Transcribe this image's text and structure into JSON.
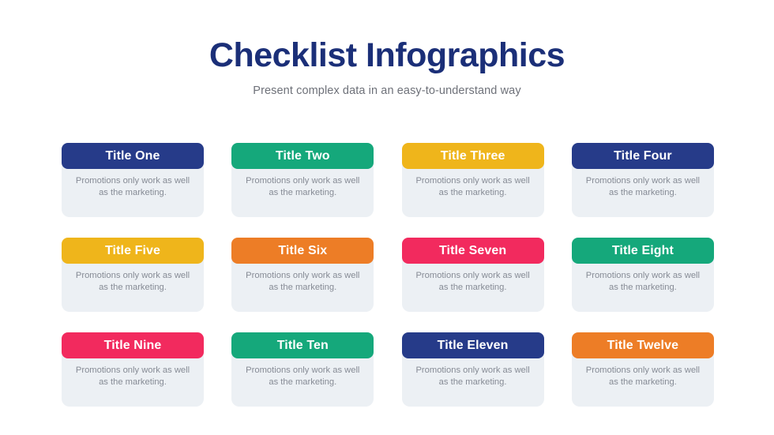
{
  "header": {
    "title": "Checklist Infographics",
    "subtitle": "Present complex data in an easy-to-understand way",
    "title_color": "#1b2f78",
    "subtitle_color": "#6e7179"
  },
  "theme": {
    "background": "#ffffff",
    "card_body_bg": "#ecf0f4",
    "card_text_color": "#868b95",
    "navy": "#263b89",
    "green": "#15a87b",
    "yellow": "#efb51b",
    "orange": "#ed7d26",
    "pink": "#f22a5e"
  },
  "cards": [
    {
      "title": "Title One",
      "text": "Promotions only work as well as the marketing.",
      "color": "#263b89"
    },
    {
      "title": "Title Two",
      "text": "Promotions only work as well as the marketing.",
      "color": "#15a87b"
    },
    {
      "title": "Title Three",
      "text": "Promotions only work as well as the marketing.",
      "color": "#efb51b"
    },
    {
      "title": "Title Four",
      "text": "Promotions only work as well as the marketing.",
      "color": "#263b89"
    },
    {
      "title": "Title Five",
      "text": "Promotions only work as well as the marketing.",
      "color": "#efb51b"
    },
    {
      "title": "Title Six",
      "text": "Promotions only work as well as the marketing.",
      "color": "#ed7d26"
    },
    {
      "title": "Title Seven",
      "text": "Promotions only work as well as the marketing.",
      "color": "#f22a5e"
    },
    {
      "title": "Title Eight",
      "text": "Promotions only work as well as the marketing.",
      "color": "#15a87b"
    },
    {
      "title": "Title Nine",
      "text": "Promotions only work as well as the marketing.",
      "color": "#f22a5e"
    },
    {
      "title": "Title Ten",
      "text": "Promotions only work as well as the marketing.",
      "color": "#15a87b"
    },
    {
      "title": "Title Eleven",
      "text": "Promotions only work as well as the marketing.",
      "color": "#263b89"
    },
    {
      "title": "Title Twelve",
      "text": "Promotions only work as well as the marketing.",
      "color": "#ed7d26"
    }
  ]
}
